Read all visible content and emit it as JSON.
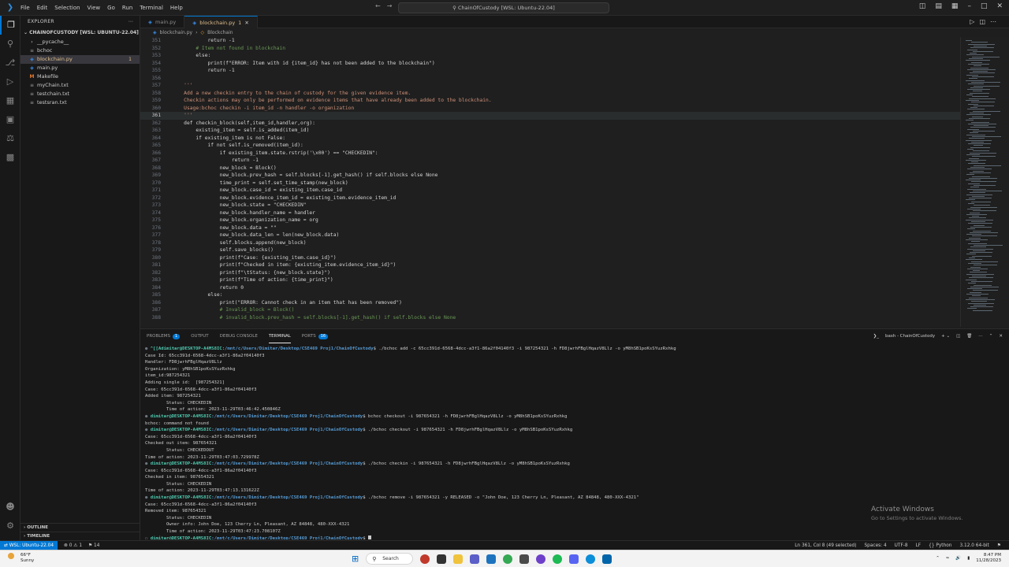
{
  "titlebar": {
    "menu": [
      "File",
      "Edit",
      "Selection",
      "View",
      "Go",
      "Run",
      "Terminal",
      "Help"
    ],
    "search": "ChainOfCustody [WSL: Ubuntu-22.04]"
  },
  "sidebar": {
    "title": "EXPLORER",
    "folder": "CHAINOFCUSTODY [WSL: UBUNTU-22.04]",
    "files": [
      {
        "name": "__pycache__",
        "icon": "chevron-right"
      },
      {
        "name": "bchoc",
        "icon": "file"
      },
      {
        "name": "blockchain.py",
        "icon": "python",
        "badge": "1"
      },
      {
        "name": "main.py",
        "icon": "python"
      },
      {
        "name": "Makefile",
        "icon": "makefile"
      },
      {
        "name": "myChain.txt",
        "icon": "text"
      },
      {
        "name": "testchain.txt",
        "icon": "text"
      },
      {
        "name": "testsran.txt",
        "icon": "text"
      }
    ],
    "outline": "OUTLINE",
    "timeline": "TIMELINE"
  },
  "tabs": [
    {
      "label": "main.py"
    },
    {
      "label": "blockchain.py",
      "badge": "1"
    }
  ],
  "breadcrumb": [
    "blockchain.py",
    "Blockchain"
  ],
  "code": [
    {
      "n": "351",
      "t": "            return -1"
    },
    {
      "n": "352",
      "t": "        # Item not found in blockchain"
    },
    {
      "n": "353",
      "t": "        else:"
    },
    {
      "n": "354",
      "t": "            print(f\"ERROR: Item with id {item_id} has not been added to the blockchain\")"
    },
    {
      "n": "355",
      "t": "            return -1"
    },
    {
      "n": "356",
      "t": ""
    },
    {
      "n": "357",
      "t": "    '''"
    },
    {
      "n": "358",
      "t": "    Add a new checkin entry to the chain of custody for the given evidence item."
    },
    {
      "n": "359",
      "t": "    Checkin actions may only be performed on evidence items that have already been added to the blockchain."
    },
    {
      "n": "360",
      "t": "    Usage:bchoc checkin -i item_id -n handler -o organization"
    },
    {
      "n": "361",
      "t": "    '''"
    },
    {
      "n": "362",
      "t": "    def checkin_block(self,item_id,handler,org):"
    },
    {
      "n": "363",
      "t": "        existing_item = self.is_added(item_id)"
    },
    {
      "n": "364",
      "t": "        if existing_item is not False:"
    },
    {
      "n": "365",
      "t": "            if not self.is_removed(item_id):"
    },
    {
      "n": "366",
      "t": "                if existing_item.state.rstrip('\\x00') == \"CHECKEDIN\":"
    },
    {
      "n": "367",
      "t": "                    return -1"
    },
    {
      "n": "368",
      "t": "                new_block = Block()"
    },
    {
      "n": "369",
      "t": "                new_block.prev_hash = self.blocks[-1].get_hash() if self.blocks else None"
    },
    {
      "n": "370",
      "t": "                time_print = self.set_time_stamp(new_block)"
    },
    {
      "n": "371",
      "t": "                new_block.case_id = existing_item.case_id"
    },
    {
      "n": "372",
      "t": "                new_block.evidence_item_id = existing_item.evidence_item_id"
    },
    {
      "n": "373",
      "t": "                new_block.state = \"CHECKEDIN\""
    },
    {
      "n": "374",
      "t": "                new_block.handler_name = handler"
    },
    {
      "n": "375",
      "t": "                new_block.organization_name = org"
    },
    {
      "n": "376",
      "t": "                new_block.data = \"\""
    },
    {
      "n": "377",
      "t": "                new_block.data_len = len(new_block.data)"
    },
    {
      "n": "378",
      "t": "                self.blocks.append(new_block)"
    },
    {
      "n": "379",
      "t": "                self.save_blocks()"
    },
    {
      "n": "380",
      "t": "                print(f\"Case: {existing_item.case_id}\")"
    },
    {
      "n": "381",
      "t": "                print(f\"Checked in item: {existing_item.evidence_item_id}\")"
    },
    {
      "n": "382",
      "t": "                print(f\"\\tStatus: {new_block.state}\")"
    },
    {
      "n": "383",
      "t": "                print(f\"Time of action: {time_print}\")"
    },
    {
      "n": "384",
      "t": "                return 0"
    },
    {
      "n": "385",
      "t": "            else:"
    },
    {
      "n": "386",
      "t": "                print(\"ERROR: Cannot check in an item that has been removed\")"
    },
    {
      "n": "387",
      "t": "                # Invalid_block = Block()"
    },
    {
      "n": "388",
      "t": "                # invalid_block.prev_hash = self.blocks[-1].get_hash() if self.blocks else None"
    }
  ],
  "panel": {
    "tabs": [
      {
        "label": "PROBLEMS",
        "badge": "1"
      },
      {
        "label": "OUTPUT"
      },
      {
        "label": "DEBUG CONSOLE"
      },
      {
        "label": "TERMINAL"
      },
      {
        "label": "PORTS",
        "badge": "16"
      }
    ],
    "shell": "bash - ChainOfCustody"
  },
  "terminal": [
    {
      "dot": "● ",
      "user": "^[[Adimitar@DESKTOP-A4MS8IC",
      "path": ":/mnt/c/Users/Dimitar/Desktop/CSE469 Proj1/ChainOfCustody",
      "cmd": "$ ./bchoc add -c 65cc391d-6568-4dcc-a3f1-86a2f04140f3 -i 987254321 -h FD8jwrhFBglHqazV8Llz -o yM8hSB1poKsSYuzRxhkg"
    },
    {
      "text": "Case Id: 65cc391d-6568-4dcc-a3f1-86a2f04140f3"
    },
    {
      "text": "Handler: FD8jwrhFBglHqazV8Llz"
    },
    {
      "text": "Organization: yM8hSB1poKsSYuzRxhkg"
    },
    {
      "text": "item_id:987254321"
    },
    {
      "text": "Adding single id:  [987254321]"
    },
    {
      "text": "Case: 65cc391d-6568-4dcc-a3f1-86a2f04140f3"
    },
    {
      "text": "Added item: 987254321"
    },
    {
      "text": "        Status: CHECKEDIN"
    },
    {
      "text": "        Time of action: 2023-11-29T03:46:42.450846Z"
    },
    {
      "dot": "● ",
      "user": "dimitar@DESKTOP-A4MS8IC",
      "path": ":/mnt/c/Users/Dimitar/Desktop/CSE469 Proj1/ChainOfCustody",
      "cmd": "$ bchoc checkout -i 987654321 -h FD8jwrhFBglHqazV8Llz -o yM8hSB1poKsSYuzRxhkg"
    },
    {
      "text": "bchoc: command not found"
    },
    {
      "dot": "● ",
      "user": "dimitar@DESKTOP-A4MS8IC",
      "path": ":/mnt/c/Users/Dimitar/Desktop/CSE469 Proj1/ChainOfCustody",
      "cmd": "$ ./bchoc checkout -i 987654321 -h FD8jwrhFBglHqazV8Llz -o yM8hSB1poKsSYuzRxhkg"
    },
    {
      "text": "Case: 65cc391d-6568-4dcc-a3f1-86a2f04140f3"
    },
    {
      "text": "Checked out item: 987654321"
    },
    {
      "text": "        Status: CHECKEDOUT"
    },
    {
      "text": "Time of action: 2023-11-29T03:47:03.729978Z"
    },
    {
      "dot": "● ",
      "user": "dimitar@DESKTOP-A4MS8IC",
      "path": ":/mnt/c/Users/Dimitar/Desktop/CSE469 Proj1/ChainOfCustody",
      "cmd": "$ ./bchoc checkin -i 987654321 -h FD8jwrhFBglHqazV8Llz -o yM8hSB1poKsSYuzRxhkg"
    },
    {
      "text": "Case: 65cc391d-6568-4dcc-a3f1-86a2f04140f3"
    },
    {
      "text": "Checked in item: 987654321"
    },
    {
      "text": "        Status: CHECKEDIN"
    },
    {
      "text": "Time of action: 2023-11-29T03:47:13.131622Z"
    },
    {
      "dot": "● ",
      "user": "dimitar@DESKTOP-A4MS8IC",
      "path": ":/mnt/c/Users/Dimitar/Desktop/CSE469 Proj1/ChainOfCustody",
      "cmd": "$ ./bchoc remove -i 987654321 -y RELEASED -o \"John Doe, 123 Cherry Ln, Pleasant, AZ 84848, 480-XXX-4321\""
    },
    {
      "text": "Case: 65cc391d-6568-4dcc-a3f1-86a2f04140f3"
    },
    {
      "text": "Removed item: 987654321"
    },
    {
      "text": "        Status: CHECKEDIN"
    },
    {
      "text": "        Owner info: John Doe, 123 Cherry Ln, Pleasant, AZ 84848, 480-XXX-4321"
    },
    {
      "text": "        Time of action: 2023-11-29T03:47:23.708107Z"
    },
    {
      "dot": "○ ",
      "user": "dimitar@DESKTOP-A4MS8IC",
      "path": ":/mnt/c/Users/Dimitar/Desktop/CSE469 Proj1/ChainOfCustody",
      "cmd": "$ "
    }
  ],
  "activate": {
    "title": "Activate Windows",
    "subtitle": "Go to Settings to activate Windows."
  },
  "statusbar": {
    "remote": "WSL: Ubuntu-22.04",
    "problems": "⊗ 0 ⚠ 1",
    "ports": "⚑ 14",
    "right": [
      "Ln 361, Col 8 (49 selected)",
      "Spaces: 4",
      "UTF-8",
      "LF",
      "{} Python",
      "3.12.0 64-bit"
    ]
  },
  "taskbar": {
    "weather_temp": "66°F",
    "weather_desc": "Sunny",
    "search": "Search",
    "time": "8:47 PM",
    "date": "11/28/2023"
  },
  "colors": {
    "accent": "#0078d4",
    "modified": "#e2c08d",
    "editor_bg": "#1f1f1f"
  }
}
